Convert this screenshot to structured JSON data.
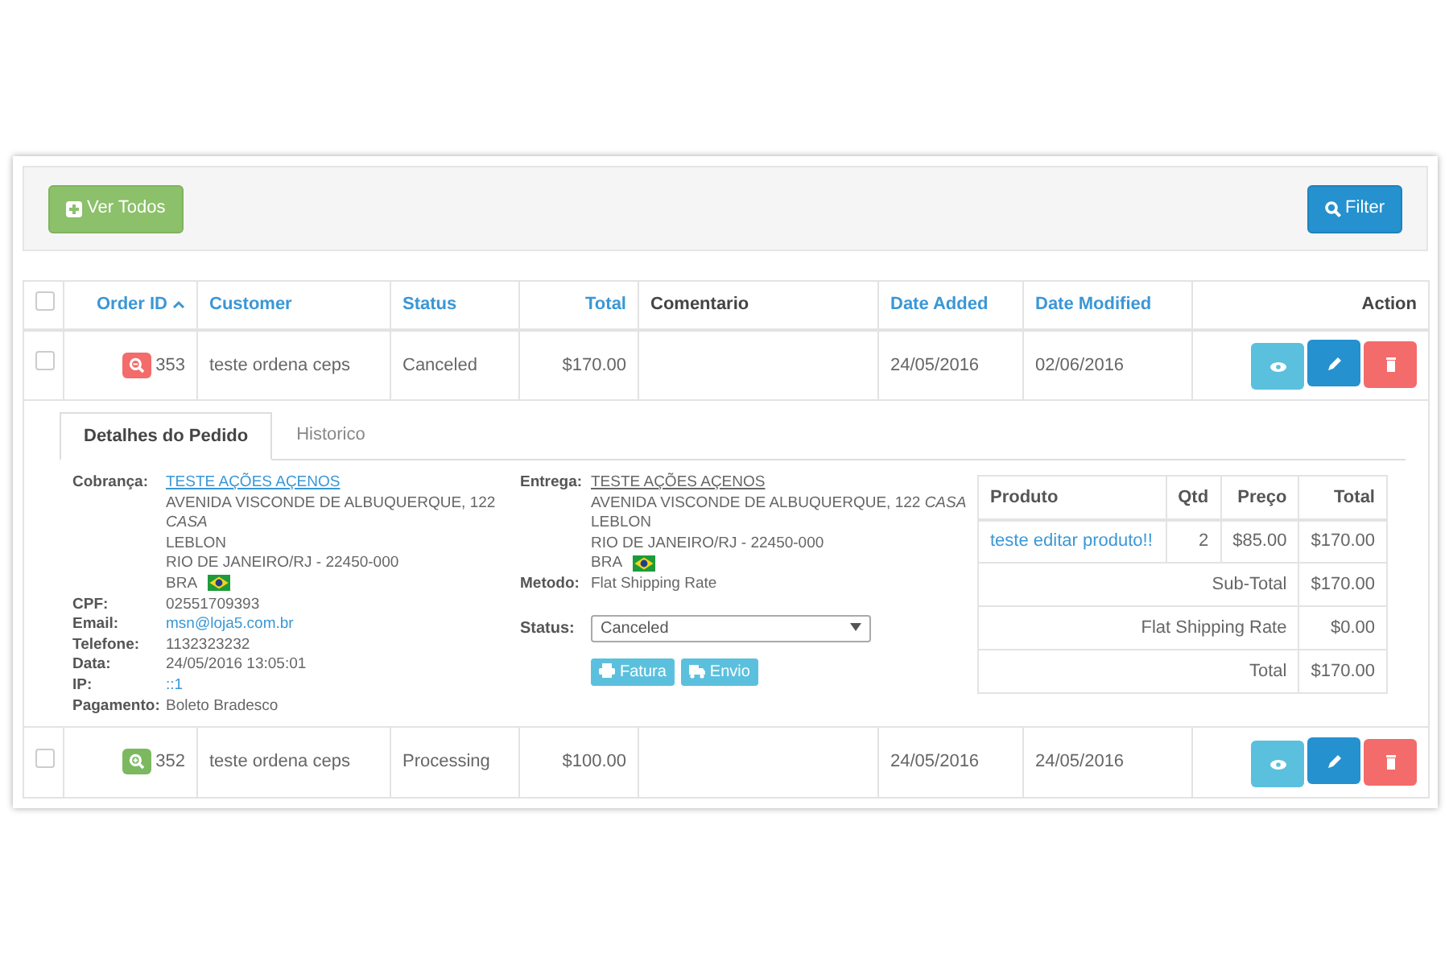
{
  "toolbar": {
    "view_all_button": "Ver Todos",
    "filter_button": "Filter"
  },
  "table": {
    "all_checked": false,
    "columns": [
      {
        "label": "Order ID",
        "kind": "sortable",
        "sorted": true
      },
      {
        "label": "Customer",
        "kind": "sortable",
        "sorted": false
      },
      {
        "label": "Status",
        "kind": "sortable",
        "sorted": false
      },
      {
        "label": "Total",
        "kind": "sortable",
        "sorted": false
      },
      {
        "label": "Comentario",
        "kind": "plain"
      },
      {
        "label": "Date Added",
        "kind": "sortable",
        "sorted": false
      },
      {
        "label": "Date Modified",
        "kind": "sortable",
        "sorted": false
      },
      {
        "label": "Action",
        "kind": "plain"
      }
    ],
    "rows": [
      {
        "checked": false,
        "expanded": true,
        "order_id": "353",
        "customer": "teste ordena ceps",
        "status": "Canceled",
        "total": "$170.00",
        "comment": "",
        "date_added": "24/05/2016",
        "date_modified": "02/06/2016"
      },
      {
        "checked": false,
        "expanded": false,
        "order_id": "352",
        "customer": "teste ordena ceps",
        "status": "Processing",
        "total": "$100.00",
        "comment": "",
        "date_added": "24/05/2016",
        "date_modified": "24/05/2016"
      }
    ]
  },
  "detail": {
    "tabs": [
      {
        "label": "Detalhes do Pedido",
        "selected": true
      },
      {
        "label": "Historico",
        "selected": false
      }
    ],
    "billing": {
      "label": "Cobrança:",
      "name": "TESTE AÇÕES AÇENOS",
      "lines": [
        {
          "text": "AVENIDA VISCONDE DE ALBUQUERQUE, 122",
          "italic": false
        },
        {
          "text": "CASA",
          "italic": true
        },
        {
          "text": "LEBLON",
          "italic": false
        },
        {
          "text": "RIO DE JANEIRO/RJ - 22450-000",
          "italic": false
        }
      ],
      "country": "BRA"
    },
    "info": [
      {
        "label": "CPF:",
        "value": "02551709393",
        "kind": "text"
      },
      {
        "label": "Email:",
        "value": "msn@loja5.com.br",
        "kind": "link"
      },
      {
        "label": "Telefone:",
        "value": "1132323232",
        "kind": "text"
      },
      {
        "label": "Data:",
        "value": "24/05/2016 13:05:01",
        "kind": "text"
      },
      {
        "label": "IP:",
        "value": "::1",
        "kind": "link"
      },
      {
        "label": "Pagamento:",
        "value": "Boleto Bradesco",
        "kind": "text"
      }
    ],
    "shipping": {
      "label": "Entrega:",
      "name": "TESTE AÇÕES AÇENOS",
      "lines": [
        "AVENIDA VISCONDE DE ALBUQUERQUE, 122 *CASA*",
        "LEBLON",
        "RIO DE JANEIRO/RJ - 22450-000"
      ],
      "country": "BRA",
      "method_label": "Metodo:",
      "method": "Flat Shipping Rate"
    },
    "status": {
      "label": "Status:",
      "value": "Canceled"
    },
    "buttons": [
      "Fatura",
      "Envio"
    ],
    "products": {
      "columns": [
        "Produto",
        "Qtd",
        "Preço",
        "Total"
      ],
      "items": [
        {
          "name": "teste editar produto!!",
          "qty": "2",
          "price": "$85.00",
          "total": "$170.00"
        }
      ],
      "totals": [
        {
          "label": "Sub-Total",
          "value": "$170.00"
        },
        {
          "label": "Flat Shipping Rate",
          "value": "$0.00"
        },
        {
          "label": "Total",
          "value": "$170.00"
        }
      ]
    }
  }
}
